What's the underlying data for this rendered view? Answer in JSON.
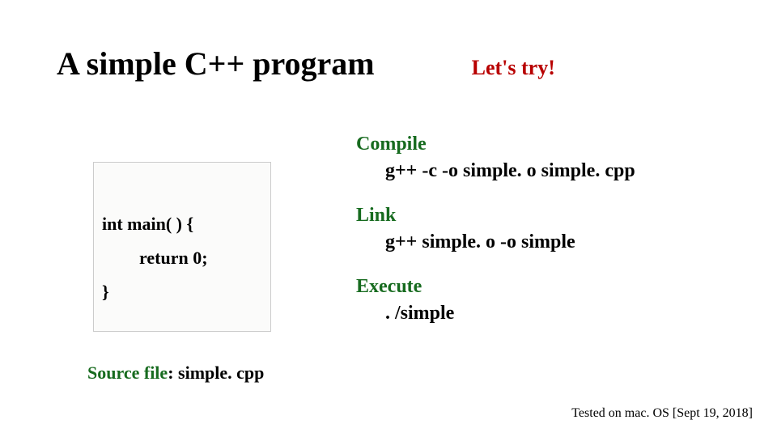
{
  "title": "A simple C++ program",
  "letsTry": "Let's try!",
  "code": {
    "line1": "int main( ) {",
    "line2": "return 0;",
    "line3": "}"
  },
  "sourceFile": {
    "label": "Source file",
    "name": ": simple. cpp"
  },
  "steps": {
    "compile": {
      "label": "Compile",
      "cmd": "g++  -c  -o  simple. o  simple. cpp"
    },
    "link": {
      "label": "Link",
      "cmd": "g++  simple. o  -o  simple"
    },
    "execute": {
      "label": "Execute",
      "cmd": ". /simple"
    }
  },
  "footnote": "Tested on mac. OS [Sept 19, 2018]"
}
